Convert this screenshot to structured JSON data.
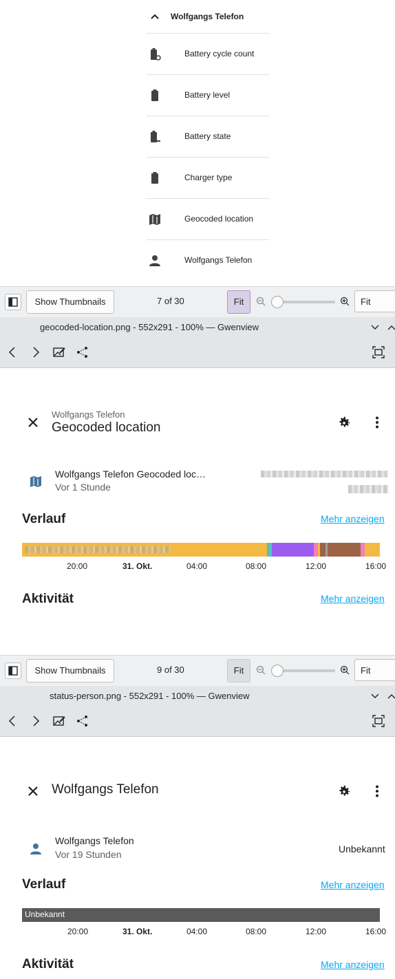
{
  "entity_list": {
    "header": "Wolfgangs Telefon",
    "items": [
      {
        "label": "Battery cycle count",
        "icon": "battery-sync-icon"
      },
      {
        "label": "Battery level",
        "icon": "battery-icon"
      },
      {
        "label": "Battery state",
        "icon": "battery-minus-icon"
      },
      {
        "label": "Charger type",
        "icon": "battery-full-icon"
      },
      {
        "label": "Geocoded location",
        "icon": "map-icon"
      },
      {
        "label": "Wolfgangs Telefon",
        "icon": "person-icon"
      }
    ]
  },
  "viewer1": {
    "toolbar": {
      "show_thumbnails": "Show Thumbnails",
      "count": "7 of 30",
      "fit": "Fit",
      "zoom_select": "Fit"
    },
    "window_title": "geocoded-location.png - 552x291 - 100% — Gwenview",
    "dialog": {
      "subtitle": "Wolfgangs Telefon",
      "title": "Geocoded location",
      "entity_name": "Wolfgangs Telefon Geocoded loc…",
      "entity_time": "Vor 1 Stunde",
      "history_heading": "Verlauf",
      "history_more": "Mehr anzeigen",
      "activity_heading": "Aktivität",
      "activity_more": "Mehr anzeigen",
      "ticks": [
        "20:00",
        "31. Okt.",
        "04:00",
        "08:00",
        "12:00",
        "16:00"
      ],
      "timeline_colors": {
        "main": "#f4b942",
        "purple": "#9d5cf0",
        "brown": "#9c6444",
        "pink": "#f07fbf",
        "teal": "#4dc6c6",
        "gray": "#9e9e9e"
      }
    }
  },
  "viewer2": {
    "toolbar": {
      "show_thumbnails": "Show Thumbnails",
      "count": "9 of 30",
      "fit": "Fit",
      "zoom_select": "Fit"
    },
    "window_title": "status-person.png - 552x291 - 100% — Gwenview",
    "dialog": {
      "title": "Wolfgangs Telefon",
      "entity_name": "Wolfgangs Telefon",
      "entity_time": "Vor 19 Stunden",
      "state": "Unbekannt",
      "history_heading": "Verlauf",
      "history_more": "Mehr anzeigen",
      "timeline_label": "Unbekannt",
      "activity_heading": "Aktivität",
      "activity_more": "Mehr anzeigen",
      "ticks": [
        "20:00",
        "31. Okt.",
        "04:00",
        "08:00",
        "12:00",
        "16:00"
      ],
      "timeline_color": "#5a5a5a"
    }
  },
  "colors": {
    "ha_icon": "#44739e",
    "link": "#03a9f4",
    "gwenview_bg": "#eff0f1"
  }
}
